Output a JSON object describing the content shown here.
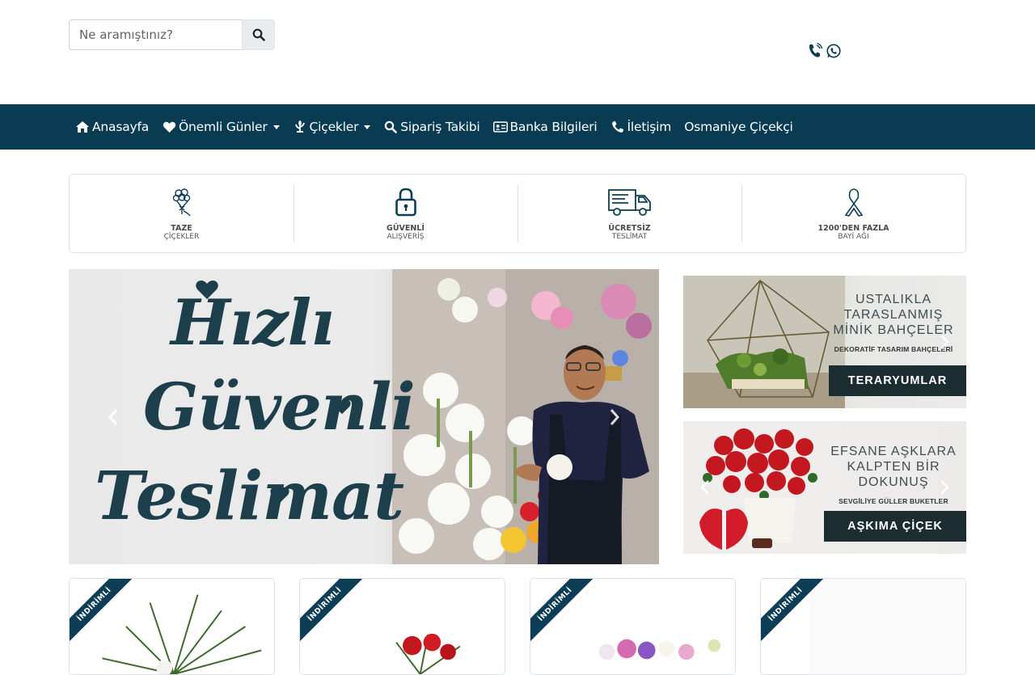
{
  "header": {
    "search_placeholder": "Ne aramıştınız?",
    "icons": [
      "search-icon",
      "phone-icon",
      "whatsapp-icon"
    ]
  },
  "nav": {
    "items": [
      {
        "label": "Anasayfa",
        "icon": "home-icon",
        "dropdown": false
      },
      {
        "label": "Önemli Günler",
        "icon": "heart-icon",
        "dropdown": true
      },
      {
        "label": "Çiçekler",
        "icon": "flower-icon",
        "dropdown": true
      },
      {
        "label": "Sipariş Takibi",
        "icon": "search-icon",
        "dropdown": false
      },
      {
        "label": "Banka Bilgileri",
        "icon": "id-card-icon",
        "dropdown": false
      },
      {
        "label": "İletişim",
        "icon": "phone-icon",
        "dropdown": false
      },
      {
        "label": "Osmaniye Çiçekçi",
        "icon": "",
        "dropdown": false
      }
    ]
  },
  "features": [
    {
      "title": "TAZE",
      "subtitle": "ÇİÇEKLER",
      "icon": "bouquet-icon"
    },
    {
      "title": "GÜVENLİ",
      "subtitle": "ALIŞVERİŞ",
      "icon": "lock-icon"
    },
    {
      "title": "ÜCRETSİZ",
      "subtitle": "TESLİMAT",
      "icon": "truck-icon"
    },
    {
      "title": "1200'DEN FAZLA",
      "subtitle": "BAYİ AĞI",
      "icon": "ribbon-icon"
    }
  ],
  "hero": {
    "words": [
      "Hızlı",
      "Güvenli",
      "Teslimat"
    ]
  },
  "banners": [
    {
      "lines": [
        "USTALIKLA",
        "TARASLANMIŞ",
        "MİNİK BAHÇELER"
      ],
      "sub": "DEKORATİF TASARIM BAHÇELERİ",
      "cta": "TERARYUMLAR"
    },
    {
      "lines": [
        "EFSANE AŞKLARA",
        "KALPTEN BİR",
        "DOKUNUŞ"
      ],
      "sub": "SEVGİLİYE GÜLLER BUKETLER",
      "cta": "AŞKIMA ÇİÇEK"
    }
  ],
  "products": [
    {
      "badge": "İNDİRİMLİ"
    },
    {
      "badge": "İNDİRİMLİ"
    },
    {
      "badge": "İNDİRİMLİ"
    },
    {
      "badge": "İNDİRİMLİ"
    }
  ],
  "colors": {
    "primary": "#093c52",
    "ribbon": "#0d3e55",
    "hero_text": "#1d3e4b",
    "banner_cta": "#1c2d31"
  }
}
